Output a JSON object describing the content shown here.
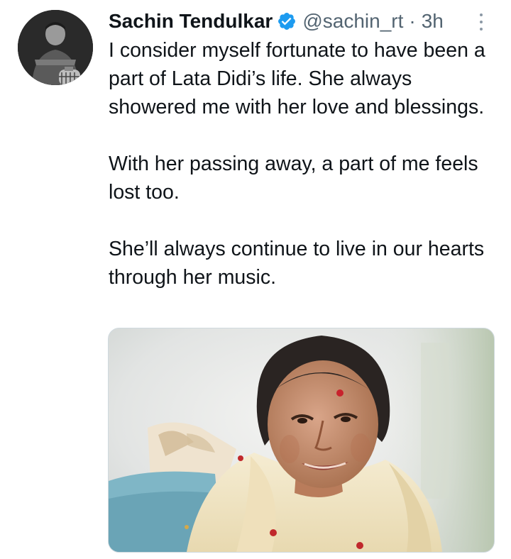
{
  "tweet": {
    "author": {
      "display_name": "Sachin Tendulkar",
      "handle": "@sachin_rt",
      "verified": true,
      "avatar_icon": "profile-photo"
    },
    "separator": "·",
    "time": "3h",
    "paragraphs": [
      "I consider myself fortunate to have been a part of Lata Didi’s life. She always showered me with her love and blessings.",
      "With her passing away, a part of me feels lost too.",
      "She’ll always continue to live in our hearts through her music."
    ],
    "media": {
      "type": "photo"
    },
    "colors": {
      "verified_badge": "#1d9bf0",
      "secondary_text": "#536471",
      "primary_text": "#0f1419"
    }
  }
}
